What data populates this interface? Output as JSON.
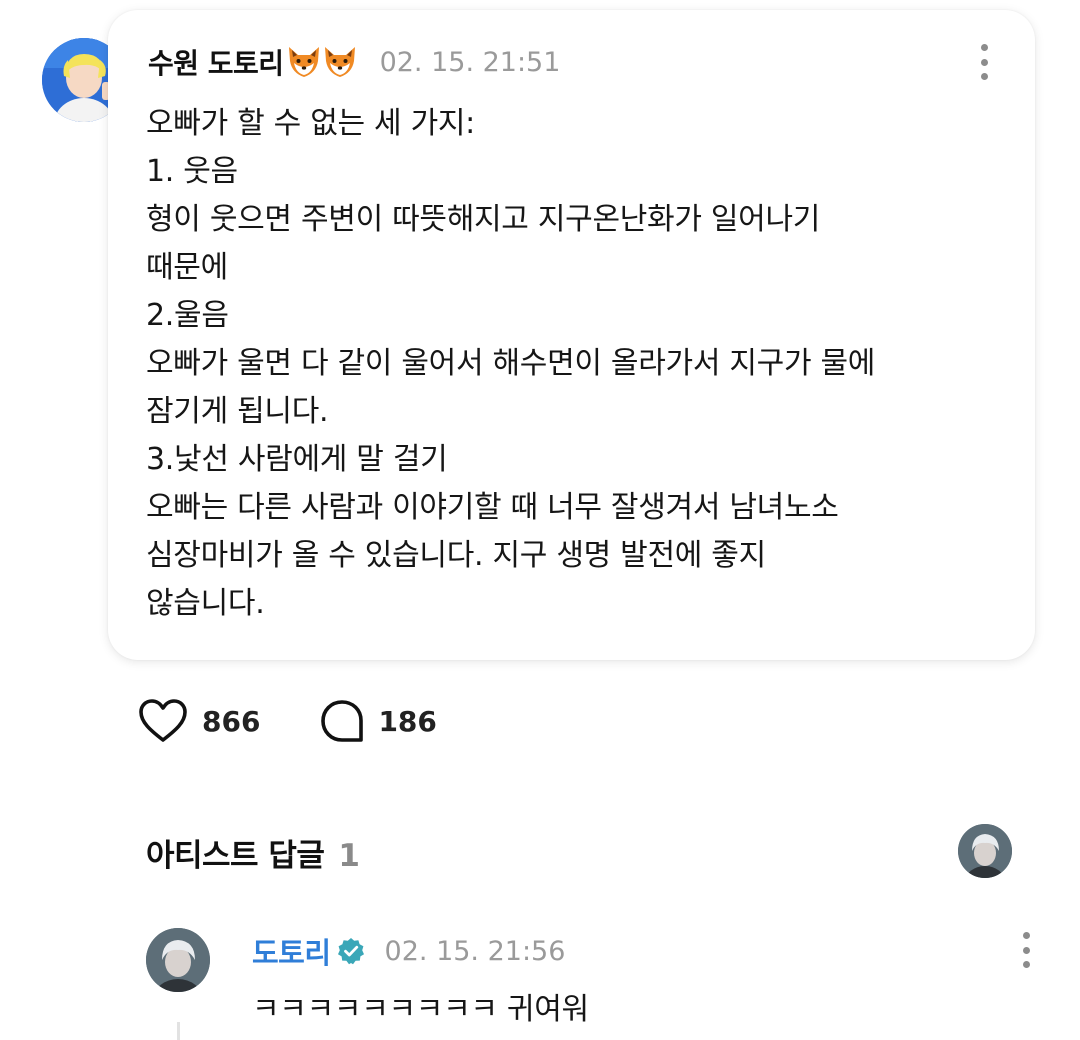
{
  "post": {
    "author": "수원 도토리",
    "author_emoji": "🦊🦊",
    "timestamp": "02. 15. 21:51",
    "lines": [
      "오빠가 할 수 없는 세 가지:",
      "1. 웃음",
      "형이 웃으면 주변이 따뜻해지고 지구온난화가 일어나기",
      "때문에",
      "2.울음",
      "오빠가 울면 다 같이 울어서 해수면이 올라가서 지구가 물에",
      "잠기게 됩니다.",
      "3.낯선 사람에게 말 걸기",
      "오빠는 다른 사람과 이야기할 때 너무 잘생겨서 남녀노소",
      "심장마비가 올 수 있습니다. 지구 생명 발전에 좋지",
      "않습니다."
    ],
    "avatar_icon": "user-avatar-icon",
    "menu_icon": "more-vertical-icon"
  },
  "actions": {
    "likes": "866",
    "comments": "186",
    "like_icon": "heart-icon",
    "comment_icon": "comment-bubble-icon"
  },
  "artist_replies": {
    "title": "아티스트 답글",
    "count": "1",
    "reply": {
      "author": "도토리",
      "timestamp": "02. 15. 21:56",
      "text": "ㅋㅋㅋㅋㅋㅋㅋㅋㅋ 귀여워",
      "verified_icon": "verified-badge-icon"
    }
  },
  "colors": {
    "artist_name": "#2f7ed8",
    "verified": "#3aa7b8",
    "timestamp": "#9a9a9a"
  }
}
